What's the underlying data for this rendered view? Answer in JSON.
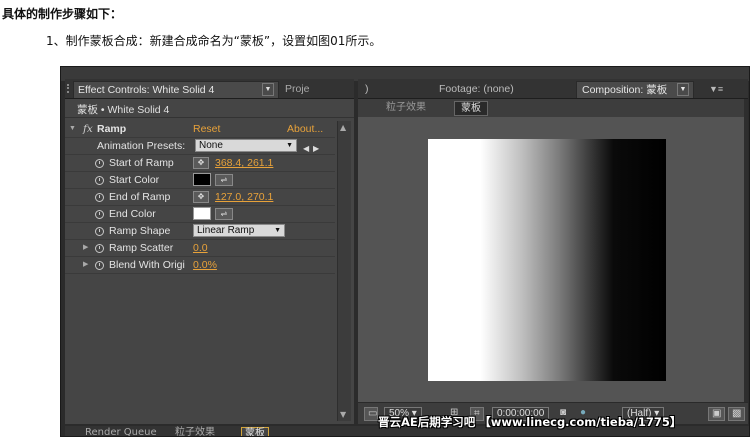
{
  "article": {
    "heading": "具体的制作步骤如下：",
    "step": "1、制作蒙板合成：新建合成命名为“蒙板”，设置如图01所示。"
  },
  "left_panel": {
    "tab_active": "Effect Controls: White Solid 4",
    "tab_dropdown": "▼",
    "tab_inactive": "Proje",
    "breadcrumb": "蒙板 • White Solid 4",
    "effect": {
      "name": "Ramp",
      "fx_label": "fx",
      "reset": "Reset",
      "about": "About..."
    },
    "presets": {
      "label": "Animation Presets:",
      "value": "None"
    },
    "properties": [
      {
        "label": "Start of Ramp",
        "value": "368.4, 261.1"
      },
      {
        "label": "Start Color",
        "color": "#000000"
      },
      {
        "label": "End of Ramp",
        "value": "127.0, 270.1"
      },
      {
        "label": "End Color",
        "color": "#ffffff"
      },
      {
        "label": "Ramp Shape",
        "value": "Linear Ramp"
      },
      {
        "label": "Ramp Scatter",
        "value": "0.0"
      },
      {
        "label": "Blend With Origi",
        "value": "0.0%"
      }
    ]
  },
  "right_panel": {
    "tab_prev": ")",
    "tab_footage": "Footage: (none)",
    "tab_comp": "Composition: 蒙板",
    "tab_menu": "▼≡",
    "crumbs": [
      "粒子效果",
      "蒙板"
    ],
    "controls": {
      "zoom": "50%",
      "timecode": "0:00:00:00",
      "resolution": "(Half)"
    }
  },
  "bottom_tabs": [
    "Render Queue",
    "粒子效果",
    "蒙板"
  ],
  "watermark": "晋云AE后期学习吧 【www.linecg.com/tieba/1775】",
  "colors": {
    "value_link": "#e8a23a",
    "panel_bg": "#454545",
    "active_tab_border": "#d2a43a"
  }
}
